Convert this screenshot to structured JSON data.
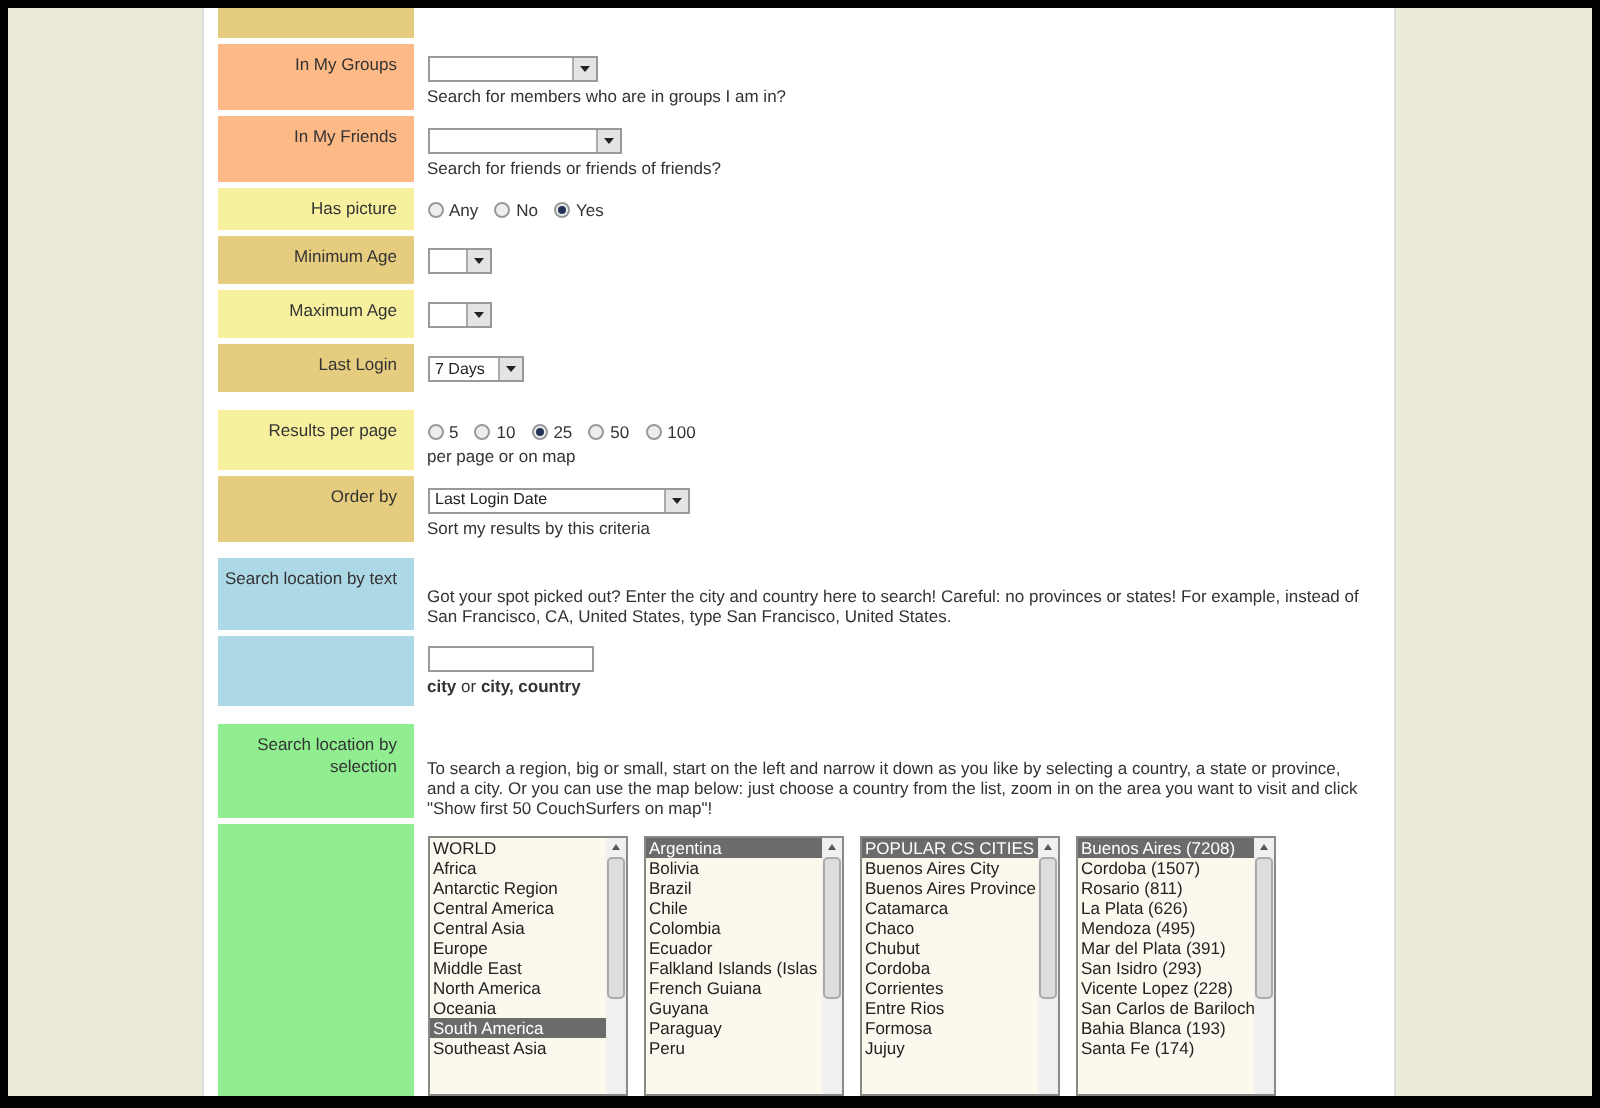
{
  "rows": [
    {
      "kind": "cut",
      "color": "#e6cc7e"
    },
    {
      "kind": "select",
      "label": "In My Groups",
      "color": "#fdb986",
      "value": "",
      "hint": "Search for members who are in groups I am in?"
    },
    {
      "kind": "select",
      "label": "In My Friends",
      "color": "#fdb986",
      "value": "",
      "hint": "Search for friends or friends of friends?"
    },
    {
      "kind": "radio",
      "label": "Has picture",
      "color": "#f7f09e",
      "options": [
        {
          "label": "Any",
          "selected": false
        },
        {
          "label": "No",
          "selected": false
        },
        {
          "label": "Yes",
          "selected": true
        }
      ]
    },
    {
      "kind": "select",
      "label": "Minimum Age",
      "color": "#e6cc7e",
      "value": ""
    },
    {
      "kind": "select",
      "label": "Maximum Age",
      "color": "#f7f09e",
      "value": ""
    },
    {
      "kind": "select",
      "label": "Last Login",
      "color": "#e6cc7e",
      "value": "7 Days"
    },
    {
      "kind": "spacer"
    },
    {
      "kind": "radio",
      "label": "Results per page",
      "color": "#f7f09e",
      "hint": "per page or on map",
      "options": [
        {
          "label": "5",
          "selected": false
        },
        {
          "label": "10",
          "selected": false
        },
        {
          "label": "25",
          "selected": true
        },
        {
          "label": "50",
          "selected": false
        },
        {
          "label": "100",
          "selected": false
        }
      ]
    },
    {
      "kind": "select",
      "label": "Order by",
      "color": "#e6cc7e",
      "value": "Last Login Date",
      "hint": "Sort my results by this criteria"
    },
    {
      "kind": "spacer"
    },
    {
      "kind": "text",
      "label": "Search location by text",
      "color": "#add8e6",
      "text": "Got your spot picked out? Enter the city and country here to search! Careful: no provinces or states! For example, instead of San Francisco, CA, United States, type San Francisco, United States."
    },
    {
      "kind": "input",
      "color": "#add8e6",
      "value": "",
      "hint": "**city** or **city, country**"
    },
    {
      "kind": "spacer"
    },
    {
      "kind": "text",
      "label": "Search location by selection",
      "color": "#90ee90",
      "text": "To search a region, big or small, start on the left and narrow it down as you like by selecting a country, a state or province, and a city. Or you can use the map below: just choose a country from the list, zoom in on the area you want to visit and click \"Show first 50 CouchSurfers on map\"!"
    },
    {
      "kind": "lists",
      "color": "#90ee90",
      "lists": [
        {
          "items": [
            {
              "label": "WORLD",
              "selected": false
            },
            {
              "label": "Africa",
              "selected": false
            },
            {
              "label": "Antarctic Region",
              "selected": false
            },
            {
              "label": "Central America",
              "selected": false
            },
            {
              "label": "Central Asia",
              "selected": false
            },
            {
              "label": "Europe",
              "selected": false
            },
            {
              "label": "Middle East",
              "selected": false
            },
            {
              "label": "North America",
              "selected": false
            },
            {
              "label": "Oceania",
              "selected": false
            },
            {
              "label": "South America",
              "selected": true
            },
            {
              "label": "Southeast Asia",
              "selected": false
            }
          ]
        },
        {
          "items": [
            {
              "label": "Argentina",
              "selected": true
            },
            {
              "label": "Bolivia",
              "selected": false
            },
            {
              "label": "Brazil",
              "selected": false
            },
            {
              "label": "Chile",
              "selected": false
            },
            {
              "label": "Colombia",
              "selected": false
            },
            {
              "label": "Ecuador",
              "selected": false
            },
            {
              "label": "Falkland Islands (Islas",
              "selected": false
            },
            {
              "label": "French Guiana",
              "selected": false
            },
            {
              "label": "Guyana",
              "selected": false
            },
            {
              "label": "Paraguay",
              "selected": false
            },
            {
              "label": "Peru",
              "selected": false
            }
          ]
        },
        {
          "items": [
            {
              "label": "POPULAR CS CITIES",
              "selected": true
            },
            {
              "label": "Buenos Aires City",
              "selected": false
            },
            {
              "label": "Buenos Aires Province",
              "selected": false
            },
            {
              "label": "Catamarca",
              "selected": false
            },
            {
              "label": "Chaco",
              "selected": false
            },
            {
              "label": "Chubut",
              "selected": false
            },
            {
              "label": "Cordoba",
              "selected": false
            },
            {
              "label": "Corrientes",
              "selected": false
            },
            {
              "label": "Entre Rios",
              "selected": false
            },
            {
              "label": "Formosa",
              "selected": false
            },
            {
              "label": "Jujuy",
              "selected": false
            }
          ]
        },
        {
          "items": [
            {
              "label": "Buenos Aires (7208)",
              "selected": true
            },
            {
              "label": "Cordoba (1507)",
              "selected": false
            },
            {
              "label": "Rosario (811)",
              "selected": false
            },
            {
              "label": "La Plata (626)",
              "selected": false
            },
            {
              "label": "Mendoza (495)",
              "selected": false
            },
            {
              "label": "Mar del Plata (391)",
              "selected": false
            },
            {
              "label": "San Isidro (293)",
              "selected": false
            },
            {
              "label": "Vicente Lopez (228)",
              "selected": false
            },
            {
              "label": "San Carlos de Bariloch",
              "selected": false
            },
            {
              "label": "Bahia Blanca (193)",
              "selected": false
            },
            {
              "label": "Santa Fe (174)",
              "selected": false
            }
          ]
        }
      ]
    }
  ]
}
